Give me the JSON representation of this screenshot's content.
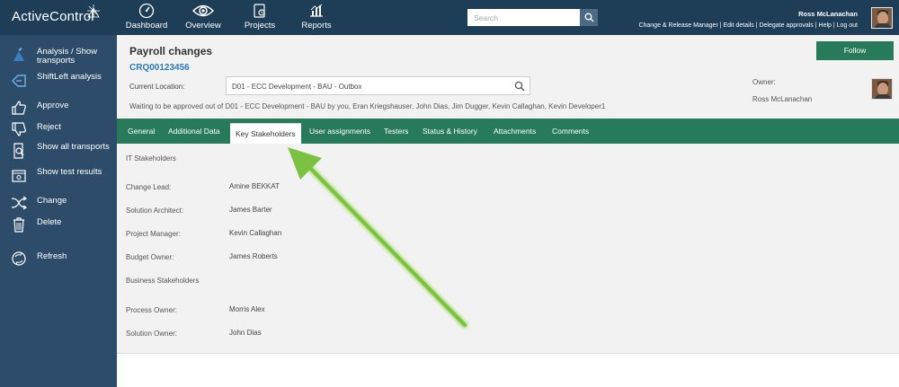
{
  "app": {
    "logo": "ActiveControl"
  },
  "nav": [
    {
      "label": "Dashboard",
      "icon": "dashboard-icon"
    },
    {
      "label": "Overview",
      "icon": "eye-icon"
    },
    {
      "label": "Projects",
      "icon": "projects-icon"
    },
    {
      "label": "Reports",
      "icon": "reports-icon"
    }
  ],
  "search": {
    "placeholder": "Search"
  },
  "user": {
    "name": "Ross McLanachan",
    "links": [
      "Change & Release Manager",
      "Edit details",
      "Delegate approvals",
      "Help",
      "Log out"
    ]
  },
  "sidebar": {
    "items": [
      {
        "label": "Analysis / Show transports",
        "icon": "analysis-icon"
      },
      {
        "label": "ShiftLeft analysis",
        "icon": "shiftleft-icon"
      },
      {
        "label": "Approve",
        "icon": "thumbs-up-icon"
      },
      {
        "label": "Reject",
        "icon": "thumbs-down-icon"
      },
      {
        "label": "Show all transports",
        "icon": "search-doc-icon"
      },
      {
        "label": "Show test results",
        "icon": "test-results-icon"
      },
      {
        "label": "Change",
        "icon": "shuffle-icon"
      },
      {
        "label": "Delete",
        "icon": "trash-icon"
      },
      {
        "label": "Refresh",
        "icon": "refresh-icon"
      }
    ]
  },
  "header": {
    "title": "Payroll changes",
    "id": "CRQ00123456",
    "location_label": "Current Location:",
    "location_value": "D01 - ECC Development - BAU - Outbox",
    "waiting": "Waiting to be approved out of D01 - ECC Development - BAU by you, Eran Kriegshauser, John Dias, Jim Dugger, Kevin Callaghan, Kevin Developer1",
    "follow_label": "Follow",
    "owner_label": "Owner:",
    "owner_name": "Ross McLanachan"
  },
  "tabs": [
    {
      "label": "General"
    },
    {
      "label": "Additional Data"
    },
    {
      "label": "Key Stakeholders",
      "active": true
    },
    {
      "label": "User assignments"
    },
    {
      "label": "Testers"
    },
    {
      "label": "Status & History"
    },
    {
      "label": "Attachments"
    },
    {
      "label": "Comments"
    }
  ],
  "stakeholders": {
    "it_section": "IT Stakeholders",
    "it": [
      {
        "role": "Change Lead:",
        "name": "Amine BEKKAT"
      },
      {
        "role": "Solution Architect:",
        "name": "James Barter"
      },
      {
        "role": "Project Manager:",
        "name": "Kevin Callaghan"
      },
      {
        "role": "Budget Owner:",
        "name": "James Roberts"
      }
    ],
    "business_section": "Business Stakeholders",
    "business": [
      {
        "role": "Process Owner:",
        "name": "Morris Alex"
      },
      {
        "role": "Solution Owner:",
        "name": "John Dias"
      }
    ]
  },
  "colors": {
    "topbar": "#1e3d57",
    "sidebar": "#2d4c69",
    "accent_green": "#277a5a",
    "link_blue": "#2a7ab8",
    "annotation_arrow": "#7cc242"
  }
}
